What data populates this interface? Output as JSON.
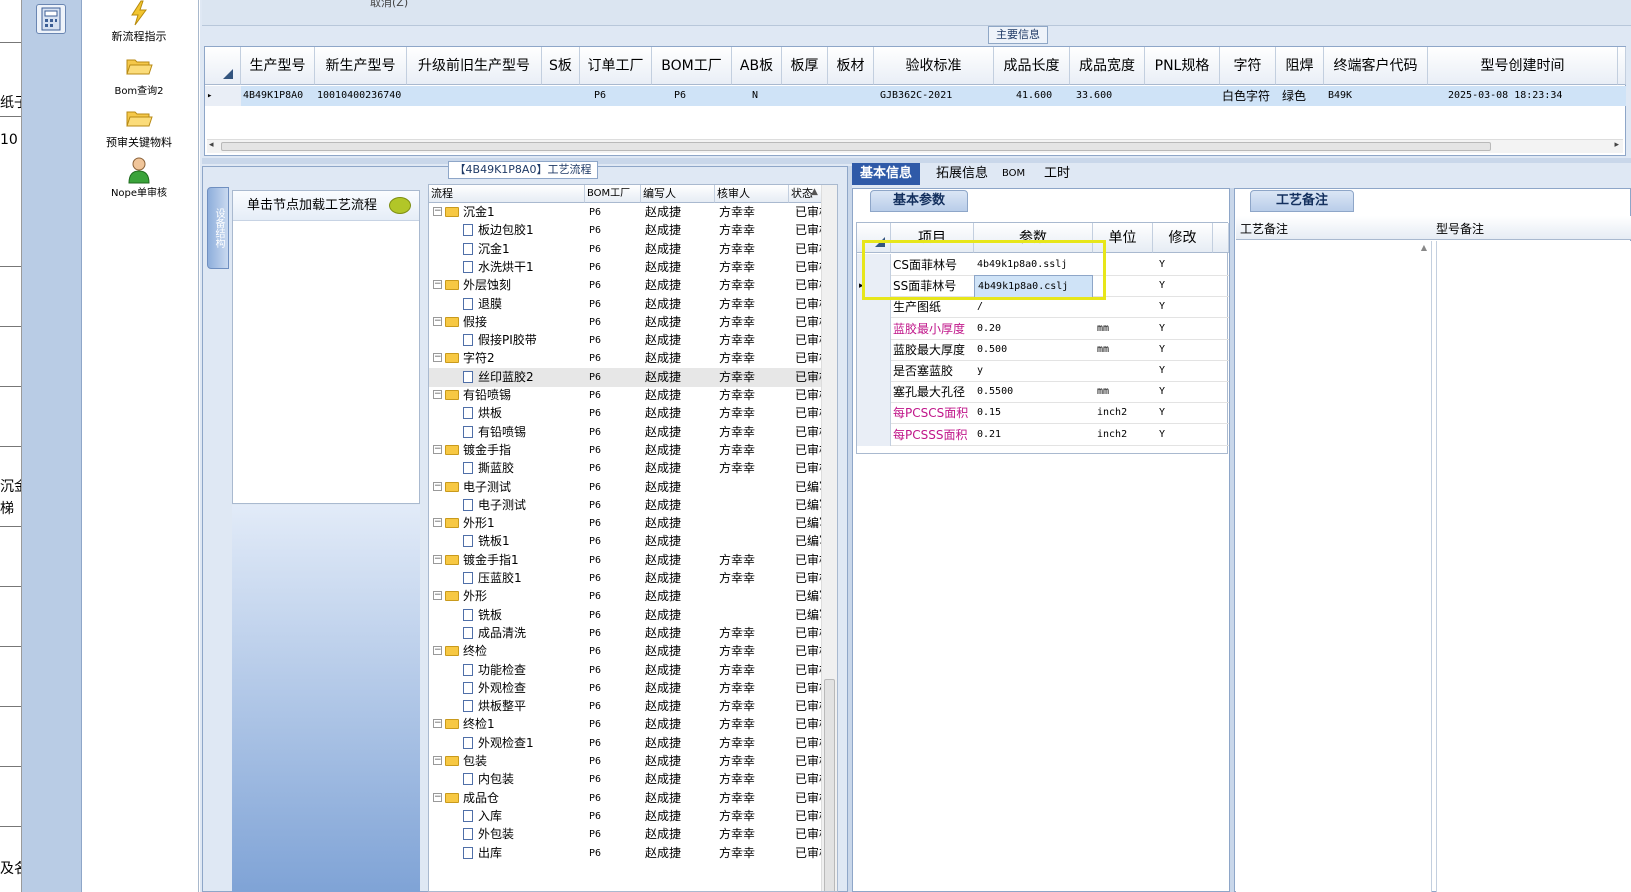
{
  "left_strip": {
    "fragments": [
      "纸子",
      "10",
      "沉金",
      "梯",
      "及名"
    ]
  },
  "toolbar": {
    "items": [
      {
        "label": "新流程指示",
        "icon": "lightning-icon"
      },
      {
        "label": "Bom查询2",
        "icon": "folder-open-icon"
      },
      {
        "label": "预审关键物料",
        "icon": "folder-open-icon"
      },
      {
        "label": "Nope单审核",
        "icon": "user-icon"
      }
    ]
  },
  "top_strip": {
    "cancel_text": "取消(Z)"
  },
  "main_info": {
    "legend": "主要信息",
    "columns": [
      "生产型号",
      "新生产型号",
      "升级前旧生产型号",
      "S板",
      "订单工厂",
      "BOM工厂",
      "AB板",
      "板厚",
      "板材",
      "验收标准",
      "成品长度",
      "成品宽度",
      "PNL规格",
      "字符",
      "阻焊",
      "终端客户代码",
      "型号创建时间"
    ],
    "row": [
      "4B49K1P8A0",
      "10010400236740",
      "",
      "",
      "P6",
      "P6",
      "N",
      "",
      "",
      "GJB362C-2021",
      "41.600",
      "33.600",
      "",
      "白色字符",
      "绿色",
      "B49K",
      "2025-03-08 18:23:34"
    ]
  },
  "process": {
    "title": "【4B49K1P8A0】工艺流程",
    "vertical_tab": "设备结构",
    "node_hint": "单击节点加载工艺流程",
    "columns": [
      "流程",
      "BOM工厂",
      "编写人",
      "核审人",
      "状态"
    ],
    "rows": [
      {
        "name": "沉金1",
        "type": "folder",
        "bom": "P6",
        "writer": "赵成捷",
        "reviewer": "方幸幸",
        "status": "已审核"
      },
      {
        "name": "板边包胶1",
        "type": "doc",
        "bom": "P6",
        "writer": "赵成捷",
        "reviewer": "方幸幸",
        "status": "已审核"
      },
      {
        "name": "沉金1",
        "type": "doc",
        "bom": "P6",
        "writer": "赵成捷",
        "reviewer": "方幸幸",
        "status": "已审核"
      },
      {
        "name": "水洗烘干1",
        "type": "doc",
        "bom": "P6",
        "writer": "赵成捷",
        "reviewer": "方幸幸",
        "status": "已审核"
      },
      {
        "name": "外层蚀刻",
        "type": "folder",
        "bom": "P6",
        "writer": "赵成捷",
        "reviewer": "方幸幸",
        "status": "已审核"
      },
      {
        "name": "退膜",
        "type": "doc",
        "bom": "P6",
        "writer": "赵成捷",
        "reviewer": "方幸幸",
        "status": "已审核"
      },
      {
        "name": "假接",
        "type": "folder",
        "bom": "P6",
        "writer": "赵成捷",
        "reviewer": "方幸幸",
        "status": "已审核"
      },
      {
        "name": "假接PI胶带",
        "type": "doc",
        "bom": "P6",
        "writer": "赵成捷",
        "reviewer": "方幸幸",
        "status": "已审核"
      },
      {
        "name": "字符2",
        "type": "folder",
        "bom": "P6",
        "writer": "赵成捷",
        "reviewer": "方幸幸",
        "status": "已审核"
      },
      {
        "name": "丝印蓝胶2",
        "type": "doc",
        "bom": "P6",
        "writer": "赵成捷",
        "reviewer": "方幸幸",
        "status": "已审核",
        "selected": true
      },
      {
        "name": "有铅喷锡",
        "type": "folder",
        "bom": "P6",
        "writer": "赵成捷",
        "reviewer": "方幸幸",
        "status": "已审核"
      },
      {
        "name": "烘板",
        "type": "doc",
        "bom": "P6",
        "writer": "赵成捷",
        "reviewer": "方幸幸",
        "status": "已审核"
      },
      {
        "name": "有铅喷锡",
        "type": "doc",
        "bom": "P6",
        "writer": "赵成捷",
        "reviewer": "方幸幸",
        "status": "已审核"
      },
      {
        "name": "镀金手指",
        "type": "folder",
        "bom": "P6",
        "writer": "赵成捷",
        "reviewer": "方幸幸",
        "status": "已审核"
      },
      {
        "name": "撕蓝胶",
        "type": "doc",
        "bom": "P6",
        "writer": "赵成捷",
        "reviewer": "方幸幸",
        "status": "已审核"
      },
      {
        "name": "电子测试",
        "type": "folder",
        "bom": "P6",
        "writer": "赵成捷",
        "reviewer": "",
        "status": "已编写"
      },
      {
        "name": "电子测试",
        "type": "doc",
        "bom": "P6",
        "writer": "赵成捷",
        "reviewer": "",
        "status": "已编写"
      },
      {
        "name": "外形1",
        "type": "folder",
        "bom": "P6",
        "writer": "赵成捷",
        "reviewer": "",
        "status": "已编写"
      },
      {
        "name": "铣板1",
        "type": "doc",
        "bom": "P6",
        "writer": "赵成捷",
        "reviewer": "",
        "status": "已编写"
      },
      {
        "name": "镀金手指1",
        "type": "folder",
        "bom": "P6",
        "writer": "赵成捷",
        "reviewer": "方幸幸",
        "status": "已审核"
      },
      {
        "name": "压蓝胶1",
        "type": "doc",
        "bom": "P6",
        "writer": "赵成捷",
        "reviewer": "方幸幸",
        "status": "已审核"
      },
      {
        "name": "外形",
        "type": "folder",
        "bom": "P6",
        "writer": "赵成捷",
        "reviewer": "",
        "status": "已编写"
      },
      {
        "name": "铣板",
        "type": "doc",
        "bom": "P6",
        "writer": "赵成捷",
        "reviewer": "",
        "status": "已编写"
      },
      {
        "name": "成品清洗",
        "type": "doc",
        "bom": "P6",
        "writer": "赵成捷",
        "reviewer": "方幸幸",
        "status": "已审核"
      },
      {
        "name": "终检",
        "type": "folder",
        "bom": "P6",
        "writer": "赵成捷",
        "reviewer": "方幸幸",
        "status": "已审核"
      },
      {
        "name": "功能检查",
        "type": "doc",
        "bom": "P6",
        "writer": "赵成捷",
        "reviewer": "方幸幸",
        "status": "已审核"
      },
      {
        "name": "外观检查",
        "type": "doc",
        "bom": "P6",
        "writer": "赵成捷",
        "reviewer": "方幸幸",
        "status": "已审核"
      },
      {
        "name": "烘板整平",
        "type": "doc",
        "bom": "P6",
        "writer": "赵成捷",
        "reviewer": "方幸幸",
        "status": "已审核"
      },
      {
        "name": "终检1",
        "type": "folder",
        "bom": "P6",
        "writer": "赵成捷",
        "reviewer": "方幸幸",
        "status": "已审核"
      },
      {
        "name": "外观检查1",
        "type": "doc",
        "bom": "P6",
        "writer": "赵成捷",
        "reviewer": "方幸幸",
        "status": "已审核"
      },
      {
        "name": "包装",
        "type": "folder",
        "bom": "P6",
        "writer": "赵成捷",
        "reviewer": "方幸幸",
        "status": "已审核"
      },
      {
        "name": "内包装",
        "type": "doc",
        "bom": "P6",
        "writer": "赵成捷",
        "reviewer": "方幸幸",
        "status": "已审核"
      },
      {
        "name": "成品仓",
        "type": "folder",
        "bom": "P6",
        "writer": "赵成捷",
        "reviewer": "方幸幸",
        "status": "已审核"
      },
      {
        "name": "入库",
        "type": "doc",
        "bom": "P6",
        "writer": "赵成捷",
        "reviewer": "方幸幸",
        "status": "已审核"
      },
      {
        "name": "外包装",
        "type": "doc",
        "bom": "P6",
        "writer": "赵成捷",
        "reviewer": "方幸幸",
        "status": "已审核"
      },
      {
        "name": "出库",
        "type": "doc",
        "bom": "P6",
        "writer": "赵成捷",
        "reviewer": "方幸幸",
        "status": "已审核"
      }
    ]
  },
  "detail_tabs": [
    "基本信息",
    "拓展信息",
    "BOM",
    "工时"
  ],
  "basic_params": {
    "title": "基本参数",
    "columns": [
      "项目",
      "参数",
      "单位",
      "修改"
    ],
    "rows": [
      {
        "item": "CS面菲林号",
        "value": "4b49k1p8a0.sslj",
        "unit": "",
        "mod": "Y",
        "pink": false
      },
      {
        "item": "SS面菲林号",
        "value": "4b49k1p8a0.cslj",
        "unit": "",
        "mod": "Y",
        "pink": false,
        "current": true
      },
      {
        "item": "生产图纸",
        "value": "/",
        "unit": "",
        "mod": "Y",
        "pink": false
      },
      {
        "item": "蓝胶最小厚度",
        "value": "0.20",
        "unit": "mm",
        "mod": "Y",
        "pink": true
      },
      {
        "item": "蓝胶最大厚度",
        "value": "0.500",
        "unit": "mm",
        "mod": "Y",
        "pink": false
      },
      {
        "item": "是否塞蓝胶",
        "value": "y",
        "unit": "",
        "mod": "Y",
        "pink": false
      },
      {
        "item": "塞孔最大孔径",
        "value": "0.5500",
        "unit": "mm",
        "mod": "Y",
        "pink": false
      },
      {
        "item": "每PCSCS面积",
        "value": "0.15",
        "unit": "inch2",
        "mod": "Y",
        "pink": true
      },
      {
        "item": "每PCSSS面积",
        "value": "0.21",
        "unit": "inch2",
        "mod": "Y",
        "pink": true
      }
    ]
  },
  "craft_notes": {
    "title": "工艺备注",
    "col1": "工艺备注",
    "col2": "型号备注"
  },
  "colors": {
    "accent": "#2f5aa8",
    "highlight_box": "#e7e61a",
    "pink": "#c0168a"
  }
}
